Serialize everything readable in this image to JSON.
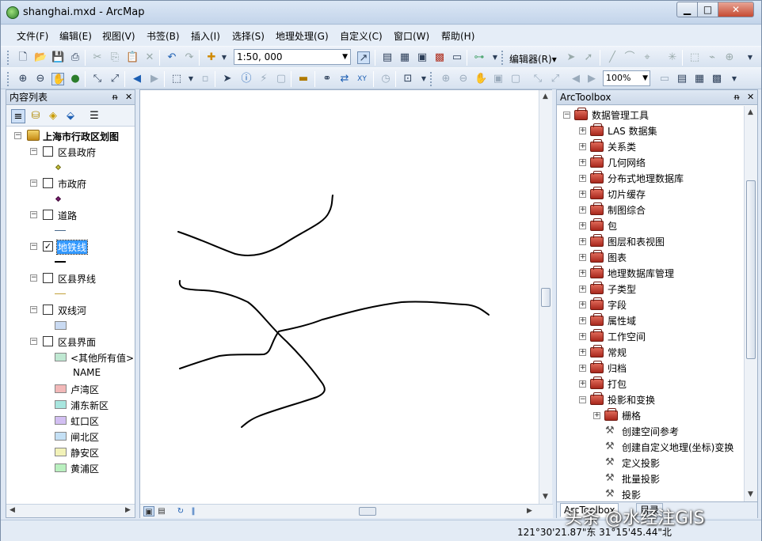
{
  "window": {
    "title": "shanghai.mxd - ArcMap",
    "min": "▁",
    "max": "□",
    "close": "✕"
  },
  "menu": [
    "文件(F)",
    "编辑(E)",
    "视图(V)",
    "书签(B)",
    "插入(I)",
    "选择(S)",
    "地理处理(G)",
    "自定义(C)",
    "窗口(W)",
    "帮助(H)"
  ],
  "toolbar": {
    "scale": "1:50, 000",
    "editor": "编辑器(R)▾",
    "zoom": "100%"
  },
  "toc": {
    "title": "内容列表",
    "pin": "ᵰ",
    "close": "✕",
    "root": "上海市行政区划图",
    "layers": [
      {
        "name": "区县政府",
        "checked": "",
        "symbol_color": "#c9c23a"
      },
      {
        "name": "市政府",
        "checked": "",
        "symbol_color": "#7a1b6e"
      },
      {
        "name": "道路",
        "checked": "",
        "symbol_color": "#4a6a8c"
      },
      {
        "name": "地铁线",
        "checked": "✓",
        "symbol_color": "#000000"
      },
      {
        "name": "区县界线",
        "checked": "",
        "symbol_color": "#c2a23a"
      },
      {
        "name": "双线河",
        "checked": "",
        "symbol_color": "#c9daf2"
      },
      {
        "name": "区县界面",
        "checked": "",
        "symbol_color": "#ffffff"
      }
    ],
    "classes": [
      {
        "label": "<其他所有值>",
        "color": "#bfe8d2"
      },
      {
        "label": "NAME",
        "color": ""
      },
      {
        "label": "卢湾区",
        "color": "#f2b8b8"
      },
      {
        "label": "浦东新区",
        "color": "#a8e6df"
      },
      {
        "label": "虹口区",
        "color": "#d2bff2"
      },
      {
        "label": "闸北区",
        "color": "#c4e0f5"
      },
      {
        "label": "静安区",
        "color": "#f2f2b8"
      },
      {
        "label": "黄浦区",
        "color": "#b9f0bf"
      }
    ]
  },
  "toolbox": {
    "title": "ArcToolbox",
    "root": "数据管理工具",
    "toolsets": [
      "LAS 数据集",
      "关系类",
      "几何网络",
      "分布式地理数据库",
      "切片缓存",
      "制图综合",
      "包",
      "图层和表视图",
      "图表",
      "地理数据库管理",
      "子类型",
      "字段",
      "属性域",
      "工作空间",
      "常规",
      "归档",
      "打包",
      "投影和变换"
    ],
    "subset": "栅格",
    "tools": [
      "创建空间参考",
      "创建自定义地理(坐标)变换",
      "定义投影",
      "批量投影",
      "投影"
    ],
    "tabs": [
      "ArcToolbox",
      "目录"
    ]
  },
  "status": {
    "coords": "121°30'21.87\"东  31°15'45.44\"北"
  },
  "watermark": "头条 @水经注GIS",
  "map_lines": {
    "color": "#000000",
    "note_count": "4"
  }
}
